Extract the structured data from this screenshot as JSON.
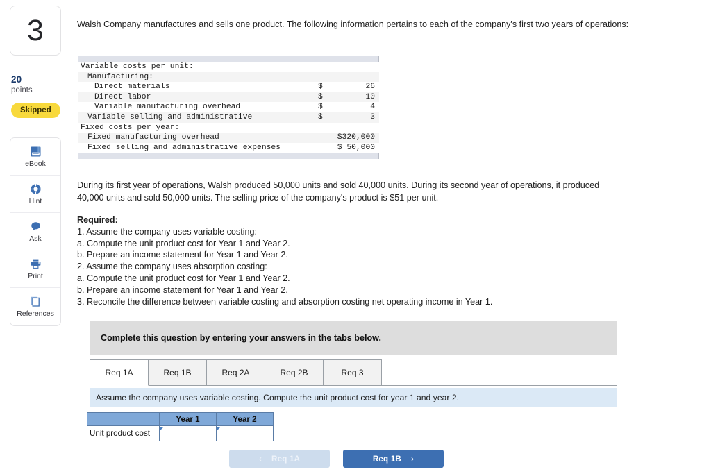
{
  "question": {
    "number": "3",
    "points_value": "20",
    "points_label": "points",
    "status_badge": "Skipped"
  },
  "tools": [
    {
      "label": "eBook",
      "icon": "ebook-icon"
    },
    {
      "label": "Hint",
      "icon": "lifebuoy-icon"
    },
    {
      "label": "Ask",
      "icon": "chat-bubble-icon"
    },
    {
      "label": "Print",
      "icon": "printer-icon"
    },
    {
      "label": "References",
      "icon": "documents-icon"
    }
  ],
  "intro_paragraph": "Walsh Company manufactures and sells one product. The following information pertains to each of the company's first two years of operations:",
  "exhibit": {
    "rows": [
      {
        "label": "Variable costs per unit:",
        "indent": 0,
        "currency": "",
        "value": "",
        "alt": false
      },
      {
        "label": "Manufacturing:",
        "indent": 1,
        "currency": "",
        "value": "",
        "alt": true
      },
      {
        "label": "Direct materials",
        "indent": 2,
        "currency": "$",
        "value": "26",
        "alt": false
      },
      {
        "label": "Direct labor",
        "indent": 2,
        "currency": "$",
        "value": "10",
        "alt": true
      },
      {
        "label": "Variable manufacturing overhead",
        "indent": 2,
        "currency": "$",
        "value": "4",
        "alt": false
      },
      {
        "label": "Variable selling and administrative",
        "indent": 1,
        "currency": "$",
        "value": "3",
        "alt": true
      },
      {
        "label": "Fixed costs per year:",
        "indent": 0,
        "currency": "",
        "value": "",
        "alt": false
      },
      {
        "label": "Fixed manufacturing overhead",
        "indent": 1,
        "currency": "",
        "value": "$320,000",
        "alt": true
      },
      {
        "label": "Fixed selling and administrative expenses",
        "indent": 1,
        "currency": "",
        "value": "$ 50,000",
        "alt": false
      }
    ]
  },
  "second_paragraph": "During its first year of operations, Walsh produced 50,000 units and sold 40,000 units. During its second year of operations, it produced 40,000 units and sold 50,000 units. The selling price of the company's product is $51 per unit.",
  "required": {
    "heading": "Required:",
    "lines": [
      "1. Assume the company uses variable costing:",
      "a. Compute the unit product cost for Year 1 and Year 2.",
      "b. Prepare an income statement for Year 1 and Year 2.",
      "2. Assume the company uses absorption costing:",
      "a. Compute the unit product cost for Year 1 and Year 2.",
      "b. Prepare an income statement for Year 1 and Year 2.",
      "3. Reconcile the difference between variable costing and absorption costing net operating income in Year 1."
    ]
  },
  "complete_banner": "Complete this question by entering your answers in the tabs below.",
  "tabs": [
    {
      "label": "Req 1A",
      "active": true
    },
    {
      "label": "Req 1B",
      "active": false
    },
    {
      "label": "Req 2A",
      "active": false
    },
    {
      "label": "Req 2B",
      "active": false
    },
    {
      "label": "Req 3",
      "active": false
    }
  ],
  "tab_instruction": "Assume the company uses variable costing. Compute the unit product cost for year 1 and year 2.",
  "answer_table": {
    "corner": "",
    "columns": [
      "Year 1",
      "Year 2"
    ],
    "rows": [
      {
        "label": "Unit product cost",
        "values": [
          "",
          ""
        ]
      }
    ]
  },
  "footer_nav": {
    "prev_label": "Req 1A",
    "prev_chevron": "‹",
    "next_label": "Req 1B",
    "next_chevron": "›"
  },
  "colors": {
    "badge_yellow": "#f8d93c",
    "points_blue": "#1b3a6b",
    "tool_icon_blue": "#3d6fb2",
    "header_blue": "#7fa8d8",
    "instruction_blue": "#dbe9f6",
    "gray_banner": "#dddddd",
    "next_button_blue": "#3d6fb2",
    "prev_button_blue": "#cddced"
  }
}
